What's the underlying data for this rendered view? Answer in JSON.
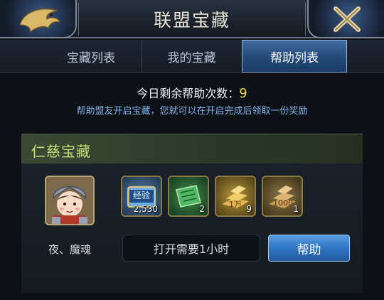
{
  "header": {
    "title": "联盟宝藏",
    "left_icon": "dragon-emblem-icon",
    "right_icon": "close-icon"
  },
  "tabs": [
    {
      "label": "宝藏列表",
      "active": false
    },
    {
      "label": "我的宝藏",
      "active": false
    },
    {
      "label": "帮助列表",
      "active": true
    }
  ],
  "info": {
    "remaining_label": "今日剩余帮助次数：",
    "remaining_count": "9",
    "description": "帮助盟友开启宝藏，您就可以在开启完成后领取一份奖励"
  },
  "treasure": {
    "title": "仁慈宝藏",
    "owner_name": "夜、魔魂",
    "rewards": [
      {
        "icon": "experience-book-icon",
        "badge": "经验",
        "quantity": "2,530"
      },
      {
        "icon": "green-scroll-icon",
        "badge": "",
        "quantity": "2"
      },
      {
        "icon": "gold-bars-icon",
        "badge": "1万",
        "quantity": "9"
      },
      {
        "icon": "bronze-bars-icon",
        "badge": "1000",
        "quantity": "1"
      }
    ],
    "open_time_text": "打开需要1小时",
    "help_button_label": "帮助"
  },
  "colors": {
    "accent_blue": "#2f74c2",
    "count_yellow": "#f1d33e",
    "panel_title_green": "#c6e07a",
    "info_blue": "#7fb3ec"
  }
}
